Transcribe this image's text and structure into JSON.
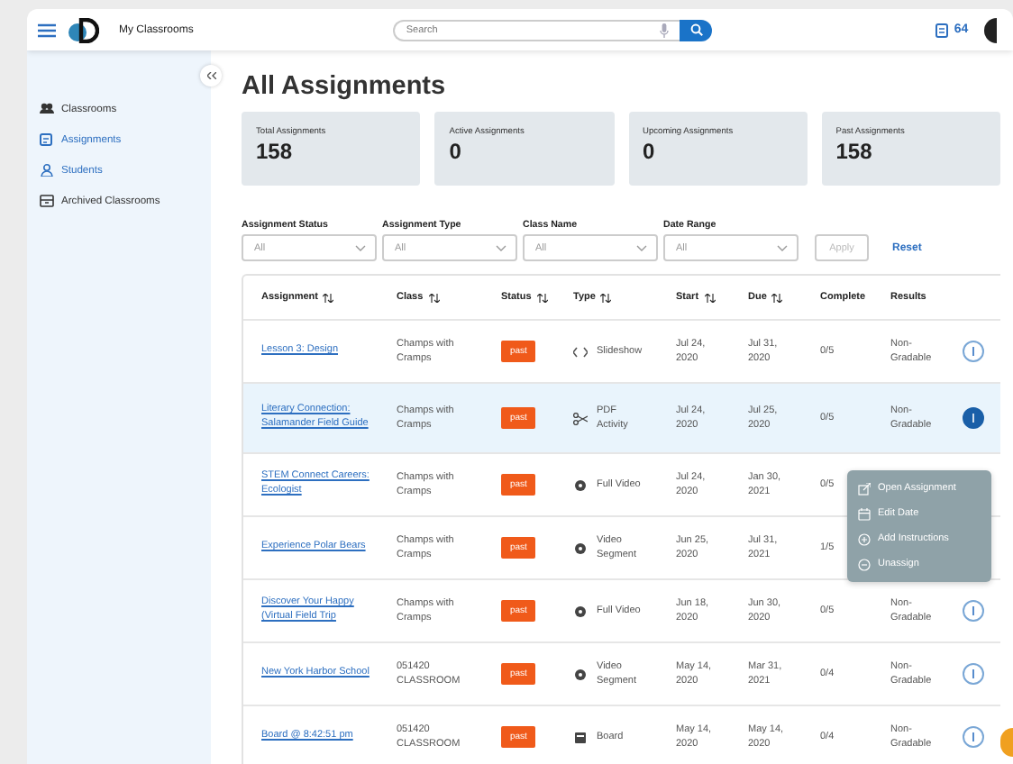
{
  "topbar": {
    "title": "My Classrooms",
    "search": {
      "placeholder": "Search"
    },
    "count": "64"
  },
  "sidebar": {
    "items": [
      {
        "kind": "classrooms",
        "label": "Classrooms",
        "selected": false
      },
      {
        "kind": "assignments",
        "label": "Assignments",
        "selected": true
      },
      {
        "kind": "students",
        "label": "Students",
        "selected": true
      },
      {
        "kind": "archive",
        "label": "Archived Classrooms",
        "selected": false
      }
    ]
  },
  "page_title": "All Assignments",
  "stats": [
    {
      "label": "Total Assignments",
      "value": "158"
    },
    {
      "label": "Active Assignments",
      "value": "0"
    },
    {
      "label": "Upcoming Assignments",
      "value": "0"
    },
    {
      "label": "Past Assignments",
      "value": "158"
    }
  ],
  "filters": [
    {
      "label": "Assignment Status",
      "value": "All"
    },
    {
      "label": "Assignment Type",
      "value": "All"
    },
    {
      "label": "Class Name",
      "value": "All"
    },
    {
      "label": "Date Range",
      "value": "All"
    }
  ],
  "apply": {
    "label": "Apply",
    "disabled": true
  },
  "reset": "Reset",
  "table": {
    "columns": [
      {
        "label": "Assignment",
        "sortable": true
      },
      {
        "label": "Class",
        "sortable": true
      },
      {
        "label": "Status",
        "sortable": true
      },
      {
        "label": "Type",
        "sortable": true
      },
      {
        "label": "Start",
        "sortable": true
      },
      {
        "label": "Due",
        "sortable": true
      },
      {
        "label": "Complete",
        "sortable": false
      },
      {
        "label": "Results",
        "sortable": false
      }
    ],
    "rows": [
      {
        "assignment": "Lesson 3: Design",
        "class": "Champs with Cramps",
        "status": "past",
        "type": {
          "kind": "slideshow",
          "label": "Slideshow"
        },
        "start": "Jul 24, 2020",
        "due": "Jul 31, 2020",
        "complete": "0/5",
        "results": "Non-Gradable",
        "selected": false
      },
      {
        "assignment": "Literary Connection: Salamander Field Guide",
        "class": "Champs with Cramps",
        "status": "past",
        "type": {
          "kind": "pdf",
          "label": "PDF Activity"
        },
        "start": "Jul 24, 2020",
        "due": "Jul 25, 2020",
        "complete": "0/5",
        "results": "Non-Gradable",
        "selected": true
      },
      {
        "assignment": "STEM Connect Careers: Ecologist",
        "class": "Champs with Cramps",
        "status": "past",
        "type": {
          "kind": "video",
          "label": "Full Video"
        },
        "start": "Jul 24, 2020",
        "due": "Jan 30, 2021",
        "complete": "0/5",
        "selected": false
      },
      {
        "assignment": "Experience Polar Bears",
        "class": "Champs with Cramps",
        "status": "past",
        "type": {
          "kind": "video",
          "label": "Video Segment"
        },
        "start": "Jun 25, 2020",
        "due": "Jul 31, 2021",
        "complete": "1/5",
        "selected": false
      },
      {
        "assignment": "Discover Your Happy (Virtual Field Trip",
        "class": "Champs with Cramps",
        "status": "past",
        "type": {
          "kind": "video",
          "label": "Full Video"
        },
        "start": "Jun 18, 2020",
        "due": "Jun 30, 2020",
        "complete": "0/5",
        "results": "Non-Gradable",
        "selected": false
      },
      {
        "assignment": "New York Harbor School",
        "class": "051420 CLASSROOM",
        "status": "past",
        "type": {
          "kind": "video",
          "label": "Video Segment"
        },
        "start": "May 14, 2020",
        "due": "Mar 31, 2021",
        "complete": "0/4",
        "results": "Non-Gradable",
        "selected": false
      },
      {
        "assignment": "Board @ 8:42:51 pm",
        "class": "051420 CLASSROOM",
        "status": "past",
        "type": {
          "kind": "board",
          "label": "Board"
        },
        "start": "May 14, 2020",
        "due": "May 14, 2020",
        "complete": "0/4",
        "results": "Non-Gradable",
        "selected": false
      }
    ]
  },
  "menu": {
    "items": [
      {
        "kind": "open",
        "label": "Open Assignment"
      },
      {
        "kind": "edit",
        "label": "Edit Date"
      },
      {
        "kind": "add",
        "label": "Add Instructions"
      },
      {
        "kind": "remove",
        "label": "Unassign"
      }
    ]
  }
}
